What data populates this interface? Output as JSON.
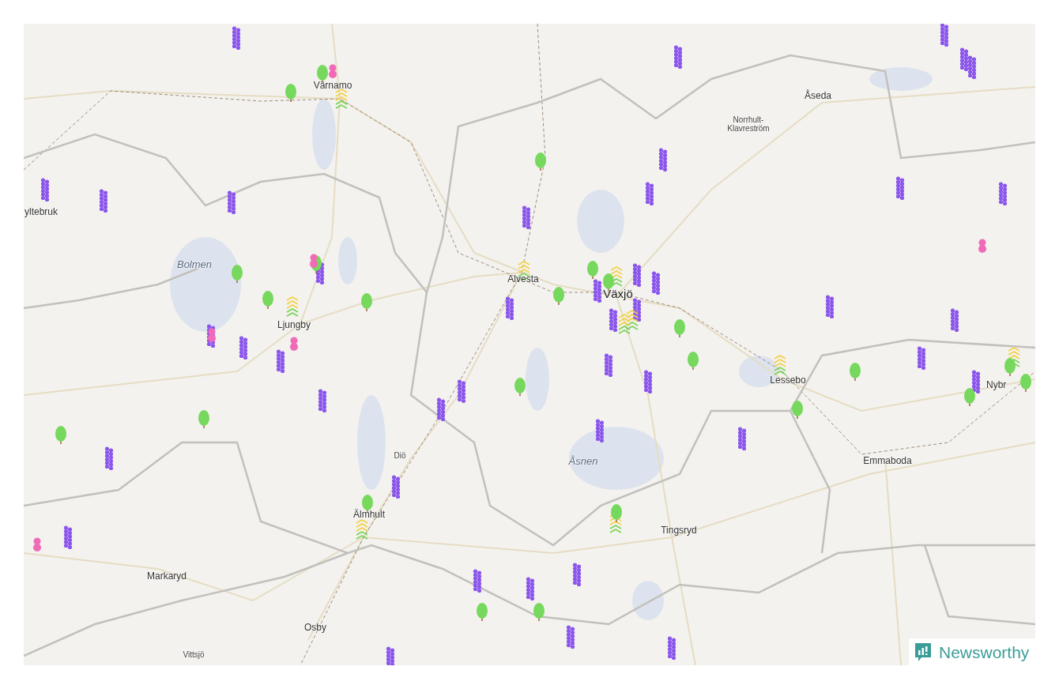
{
  "map": {
    "places": [
      {
        "name": "Värnamo",
        "kind": "town"
      },
      {
        "name": "Åseda",
        "kind": "town"
      },
      {
        "name": "Norrhult-Klavreström",
        "kind": "small"
      },
      {
        "name": "yltebruk",
        "kind": "town"
      },
      {
        "name": "Bolmen",
        "kind": "lake"
      },
      {
        "name": "Alvesta",
        "kind": "town"
      },
      {
        "name": "Växjö",
        "kind": "city"
      },
      {
        "name": "Ljungby",
        "kind": "town"
      },
      {
        "name": "Lessebo",
        "kind": "town"
      },
      {
        "name": "Nybr",
        "kind": "town"
      },
      {
        "name": "Diö",
        "kind": "small"
      },
      {
        "name": "Åsnen",
        "kind": "lake"
      },
      {
        "name": "Emmaboda",
        "kind": "town"
      },
      {
        "name": "Älmhult",
        "kind": "town"
      },
      {
        "name": "Tingsryd",
        "kind": "town"
      },
      {
        "name": "Markaryd",
        "kind": "town"
      },
      {
        "name": "Osby",
        "kind": "town"
      },
      {
        "name": "Vittsjö",
        "kind": "small"
      }
    ]
  },
  "logo": {
    "text": "Newsworthy"
  }
}
